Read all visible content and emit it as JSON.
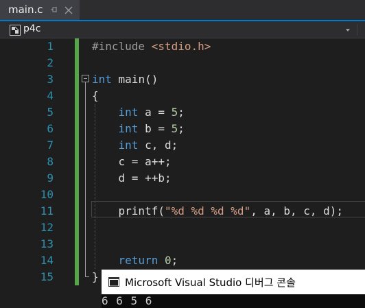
{
  "tab": {
    "title": "main.c",
    "pin_icon": "pin-icon",
    "close_icon": "close-icon"
  },
  "navbar": {
    "project": "p4c",
    "project_icon": "project-icon",
    "dropdown_icon": "chevron-down-icon"
  },
  "editor": {
    "line_numbers": [
      "1",
      "2",
      "3",
      "4",
      "5",
      "6",
      "7",
      "8",
      "9",
      "10",
      "11",
      "12",
      "13",
      "14",
      "15"
    ],
    "lines": [
      "#include <stdio.h>",
      "",
      "int main()",
      "{",
      "    int a = 5;",
      "    int b = 5;",
      "    int c, d;",
      "    c = a++;",
      "    d = ++b;",
      "",
      "    printf(\"%d %d %d %d\", a, b, c, d);",
      "",
      "",
      "    return 0;",
      "}"
    ],
    "tokens": {
      "include_directive": "#include",
      "include_file": "<stdio.h>",
      "int_kw": "int",
      "main_sig": " main()",
      "open_brace": "{",
      "a_decl": " a = ",
      "five": "5",
      "semicolon": ";",
      "b_decl": " b = ",
      "cd_decl": " c, d;",
      "c_assign": "c = a++;",
      "d_assign": "d = ++b;",
      "printf_fn": "printf(",
      "fmt_string": "\"%d %d %d %d\"",
      "printf_args": ", a, b, c, d);",
      "return_kw": "return",
      "zero": "0",
      "close_brace": "}"
    }
  },
  "console": {
    "title": "Microsoft Visual Studio 디버그 콘솔",
    "icon": "console-window-icon",
    "output": "6 6 5 6"
  },
  "colors": {
    "keyword": "#569cd6",
    "string": "#d69d85",
    "number": "#b5cea8",
    "line_number": "#2b91af",
    "change_bar": "#57a64a",
    "accent": "#007acc"
  }
}
